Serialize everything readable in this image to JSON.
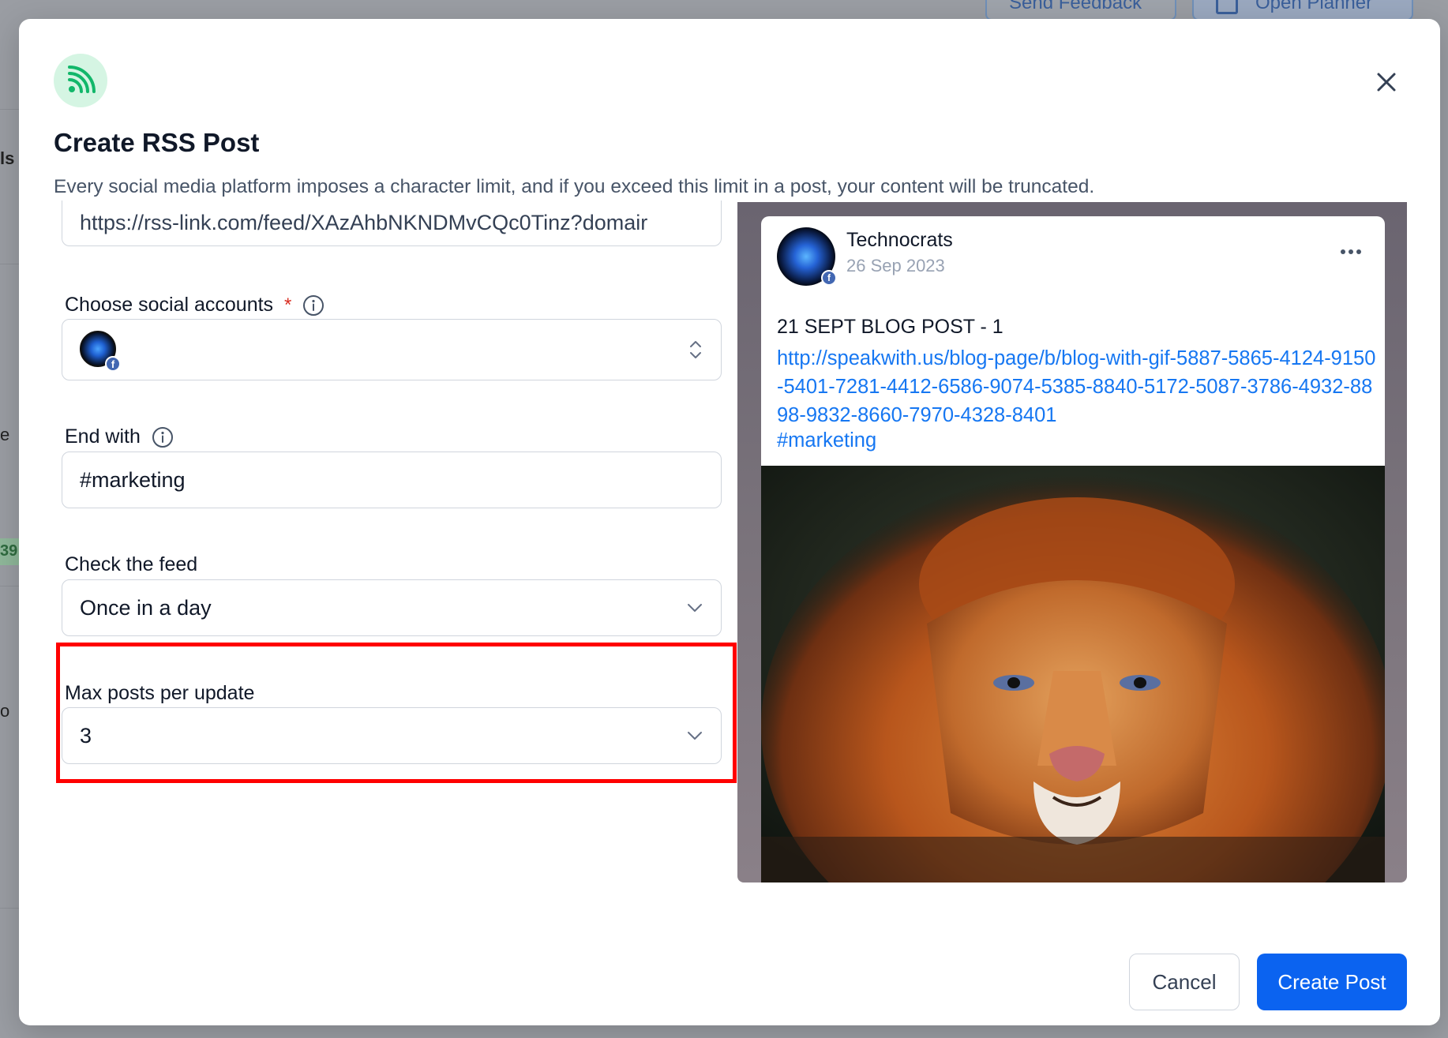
{
  "background": {
    "feedback_button": "Send Feedback",
    "planner_button": "Open Planner",
    "side_fragments": [
      "ls",
      "e",
      "39",
      "o"
    ]
  },
  "modal": {
    "icon": "rss-icon",
    "title": "Create RSS Post",
    "description": "Every social media platform imposes a character limit, and if you exceed this limit in a post, your content will be truncated.",
    "close_icon": "close-icon"
  },
  "form": {
    "feed_url": "https://rss-link.com/feed/XAzAhbNKNDMvCQc0Tinz?domair",
    "social_accounts": {
      "label": "Choose social accounts",
      "required_mark": "*"
    },
    "end_with": {
      "label": "End with",
      "value": "#marketing"
    },
    "check_feed": {
      "label": "Check the feed",
      "value": "Once in a day"
    },
    "max_posts": {
      "label": "Max posts per update",
      "value": "3"
    }
  },
  "preview": {
    "account_name": "Technocrats",
    "date": "26 Sep 2023",
    "post_title": "21 SEPT BLOG POST - 1",
    "post_link": "http://speakwith.us/blog-page/b/blog-with-gif-5887-5865-4124-9150-5401-7281-4412-6586-9074-5385-8840-5172-5087-3786-4932-8898-9832-8660-7970-4328-8401",
    "post_hashtag": "#marketing",
    "image_subject": "lion-image"
  },
  "footer": {
    "cancel_label": "Cancel",
    "create_label": "Create Post"
  },
  "colors": {
    "primary": "#0b63f0",
    "link": "#1677f2",
    "highlight": "#ff0000",
    "rss_green": "#12b76a"
  }
}
